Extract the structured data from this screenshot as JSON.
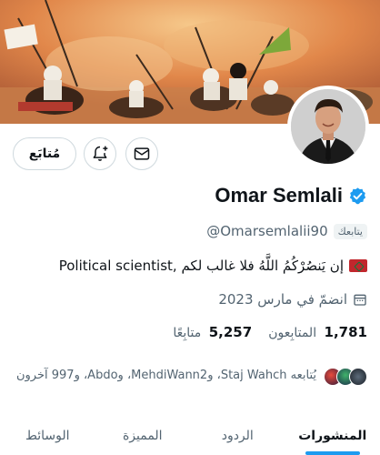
{
  "profile": {
    "display_name": "Omar Semlali",
    "handle": "@Omarsemlalii90",
    "follows_you_badge": "يتابعك",
    "bio_text": "Political scientist, إن يَنصُرْكُمُ اللَّهُ فلا غالب لكم",
    "bio_flag_icon": "morocco-flag-icon",
    "joined": "انضمّ في مارس 2023",
    "joined_icon": "calendar-icon",
    "verified_icon": "verified-badge-icon",
    "verified_color": "#1d9bf0"
  },
  "stats": {
    "following_count": "5,257",
    "following_label": "متابِعًا",
    "followers_count": "1,781",
    "followers_label": "المتابِعون"
  },
  "actions": {
    "follow_label": "مُتابَع",
    "bell_icon": "bell-plus-icon",
    "message_icon": "envelope-icon"
  },
  "followed_by": {
    "text": "يُتابعه Staj Wahch، وMehdiWann2، وAbdo، و997 آخرون"
  },
  "tabs": [
    {
      "label": "المنشورات",
      "active": true
    },
    {
      "label": "الردود",
      "active": false
    },
    {
      "label": "المميزة",
      "active": false
    },
    {
      "label": "الوسائط",
      "active": false
    }
  ],
  "colors": {
    "accent": "#1d9bf0",
    "text_primary": "#0f1419",
    "text_secondary": "#536471",
    "border": "#cfd9de"
  }
}
